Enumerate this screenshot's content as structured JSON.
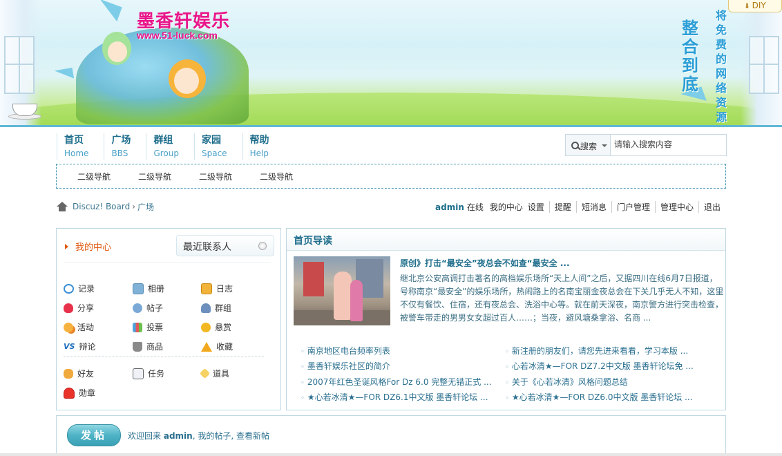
{
  "banner": {
    "site_title": "墨香轩娱乐",
    "site_url": "www.51-luck.com",
    "slogan_big": "整合到底",
    "slogan_small": "将免费的网络资源",
    "diy_label": "DIY"
  },
  "nav": {
    "items": [
      {
        "zh": "首页",
        "en": "Home"
      },
      {
        "zh": "广场",
        "en": "BBS"
      },
      {
        "zh": "群组",
        "en": "Group"
      },
      {
        "zh": "家园",
        "en": "Space"
      },
      {
        "zh": "帮助",
        "en": "Help"
      }
    ],
    "sub_items": [
      "二级导航",
      "二级导航",
      "二级导航",
      "二级导航"
    ]
  },
  "search": {
    "scope_label": "搜索",
    "placeholder": "请输入搜索内容",
    "value": ""
  },
  "breadcrumb": {
    "items": [
      "Discuz! Board",
      "广场"
    ],
    "separator": "›"
  },
  "userbar": {
    "username": "admin",
    "status": "在线",
    "links": [
      "我的中心",
      "设置",
      "提醒",
      "短消息",
      "门户管理",
      "管理中心",
      "退出"
    ]
  },
  "left_panel": {
    "my_center": "我的中心",
    "recent_contacts": "最近联系人",
    "apps": [
      {
        "label": "记录",
        "icon": "record-icon"
      },
      {
        "label": "相册",
        "icon": "album-icon"
      },
      {
        "label": "日志",
        "icon": "log-icon"
      },
      {
        "label": "分享",
        "icon": "share-icon"
      },
      {
        "label": "帖子",
        "icon": "thread-icon"
      },
      {
        "label": "群组",
        "icon": "group-icon"
      },
      {
        "label": "活动",
        "icon": "activity-icon"
      },
      {
        "label": "投票",
        "icon": "poll-icon"
      },
      {
        "label": "悬赏",
        "icon": "reward-icon"
      },
      {
        "label": "辩论",
        "icon": "debate-icon",
        "glyph": "VS"
      },
      {
        "label": "商品",
        "icon": "goods-icon"
      },
      {
        "label": "收藏",
        "icon": "favorite-icon"
      },
      {
        "label": "好友",
        "icon": "friend-icon"
      },
      {
        "label": "任务",
        "icon": "task-icon"
      },
      {
        "label": "道具",
        "icon": "prop-icon"
      },
      {
        "label": "勋章",
        "icon": "medal-icon"
      }
    ]
  },
  "right_panel": {
    "title": "首页导读",
    "headline": "原创》打击“最安全”夜总会不如查“最安全 ...",
    "summary": "继北京公安高调打击著名的高档娱乐场所“天上人间”之后，又据四川在线6月7日报道，号称南京“最安全”的娱乐场所，热闹路上的名南宝丽金夜总会在下关几乎无人不知，这里不仅有餐饮、住宿，还有夜总会、洗浴中心等。就在前天深夜，南京警方进行突击检查，被警车带走的男男女女超过百人……；当夜，避风塘桑拿浴、名商 ...",
    "links_left": [
      "南京地区电台频率列表",
      "墨香轩娱乐社区的简介",
      "2007年红色圣诞风格For Dz 6.0 完整无错正式 ...",
      "★心若冰清★—FOR DZ6.1中文版  墨香轩论坛 ..."
    ],
    "links_right": [
      "新注册的朋友们，请您先进来看看，学习本版 ...",
      "心若冰清★—FOR DZ7.2中文版  墨香轩论坛免 ...",
      "关于《心若冰清》风格问题总结",
      "★心若冰清★—FOR DZ6.0中文版  墨香轩论坛 ..."
    ]
  },
  "bottom": {
    "post_button": "发帖",
    "welcome_prefix": "欢迎回来",
    "welcome_user": "admin",
    "welcome_links": ", 我的帖子, 查看新帖"
  }
}
